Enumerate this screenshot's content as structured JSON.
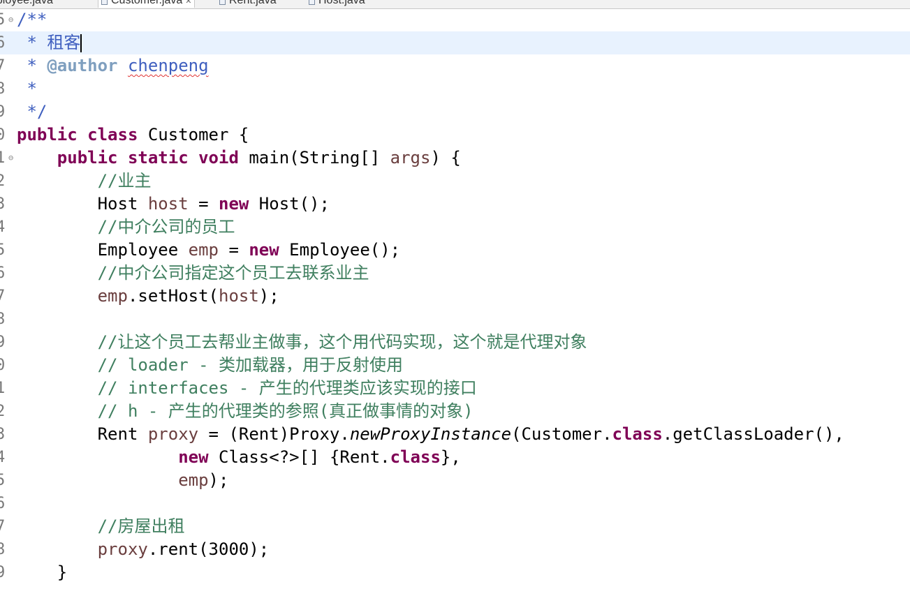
{
  "tabs": [
    {
      "label": "nployee.java",
      "active": false
    },
    {
      "label": "Customer.java",
      "active": true
    },
    {
      "label": "Rent.java",
      "active": false
    },
    {
      "label": "Host.java",
      "active": false
    }
  ],
  "lines": [
    {
      "num": "5",
      "fold": "⊖",
      "tokens": [
        {
          "t": "jdoc",
          "s": "/**"
        }
      ]
    },
    {
      "num": "6",
      "current": true,
      "cursor": true,
      "tokens": [
        {
          "t": "jdoc",
          "s": " * 租客"
        }
      ]
    },
    {
      "num": "7",
      "tokens": [
        {
          "t": "jdoc",
          "s": " * "
        },
        {
          "t": "tag",
          "s": "@author"
        },
        {
          "t": "jdoc",
          "s": " "
        },
        {
          "t": "spell",
          "s": "chenpeng"
        }
      ]
    },
    {
      "num": "8",
      "tokens": [
        {
          "t": "jdoc",
          "s": " *"
        }
      ]
    },
    {
      "num": "9",
      "tokens": [
        {
          "t": "jdoc",
          "s": " */"
        }
      ]
    },
    {
      "num": "0",
      "tokens": [
        {
          "t": "kw",
          "s": "public"
        },
        {
          "t": "plain",
          "s": " "
        },
        {
          "t": "kw",
          "s": "class"
        },
        {
          "t": "plain",
          "s": " Customer {"
        }
      ]
    },
    {
      "num": "1",
      "fold": "⊖",
      "tokens": [
        {
          "t": "plain",
          "s": "    "
        },
        {
          "t": "kw",
          "s": "public"
        },
        {
          "t": "plain",
          "s": " "
        },
        {
          "t": "kw",
          "s": "static"
        },
        {
          "t": "plain",
          "s": " "
        },
        {
          "t": "kw",
          "s": "void"
        },
        {
          "t": "plain",
          "s": " main(String[] "
        },
        {
          "t": "var",
          "s": "args"
        },
        {
          "t": "plain",
          "s": ") {"
        }
      ]
    },
    {
      "num": "2",
      "tokens": [
        {
          "t": "plain",
          "s": "        "
        },
        {
          "t": "com",
          "s": "//业主"
        }
      ]
    },
    {
      "num": "3",
      "tokens": [
        {
          "t": "plain",
          "s": "        Host "
        },
        {
          "t": "var",
          "s": "host"
        },
        {
          "t": "plain",
          "s": " = "
        },
        {
          "t": "kw",
          "s": "new"
        },
        {
          "t": "plain",
          "s": " Host();"
        }
      ]
    },
    {
      "num": "4",
      "tokens": [
        {
          "t": "plain",
          "s": "        "
        },
        {
          "t": "com",
          "s": "//中介公司的员工"
        }
      ]
    },
    {
      "num": "5",
      "tokens": [
        {
          "t": "plain",
          "s": "        Employee "
        },
        {
          "t": "var",
          "s": "emp"
        },
        {
          "t": "plain",
          "s": " = "
        },
        {
          "t": "kw",
          "s": "new"
        },
        {
          "t": "plain",
          "s": " Employee();"
        }
      ]
    },
    {
      "num": "6",
      "tokens": [
        {
          "t": "plain",
          "s": "        "
        },
        {
          "t": "com",
          "s": "//中介公司指定这个员工去联系业主"
        }
      ]
    },
    {
      "num": "7",
      "tokens": [
        {
          "t": "plain",
          "s": "        "
        },
        {
          "t": "var",
          "s": "emp"
        },
        {
          "t": "plain",
          "s": ".setHost("
        },
        {
          "t": "var",
          "s": "host"
        },
        {
          "t": "plain",
          "s": ");"
        }
      ]
    },
    {
      "num": "8",
      "tokens": []
    },
    {
      "num": "9",
      "tokens": [
        {
          "t": "plain",
          "s": "        "
        },
        {
          "t": "com",
          "s": "//让这个员工去帮业主做事，这个用代码实现，这个就是代理对象"
        }
      ]
    },
    {
      "num": "0",
      "tokens": [
        {
          "t": "plain",
          "s": "        "
        },
        {
          "t": "com",
          "s": "// loader - 类加载器，用于反射使用"
        }
      ]
    },
    {
      "num": "1",
      "tokens": [
        {
          "t": "plain",
          "s": "        "
        },
        {
          "t": "com",
          "s": "// interfaces - 产生的代理类应该实现的接口"
        }
      ]
    },
    {
      "num": "2",
      "tokens": [
        {
          "t": "plain",
          "s": "        "
        },
        {
          "t": "com",
          "s": "// h - 产生的代理类的参照(真正做事情的对象)"
        }
      ]
    },
    {
      "num": "3",
      "tokens": [
        {
          "t": "plain",
          "s": "        Rent "
        },
        {
          "t": "var",
          "s": "proxy"
        },
        {
          "t": "plain",
          "s": " = (Rent)Proxy."
        },
        {
          "t": "ital",
          "s": "newProxyInstance"
        },
        {
          "t": "plain",
          "s": "(Customer."
        },
        {
          "t": "kw",
          "s": "class"
        },
        {
          "t": "plain",
          "s": ".getClassLoader(),"
        }
      ]
    },
    {
      "num": "4",
      "tokens": [
        {
          "t": "plain",
          "s": "                "
        },
        {
          "t": "kw",
          "s": "new"
        },
        {
          "t": "plain",
          "s": " Class<?>[] {Rent."
        },
        {
          "t": "kw",
          "s": "class"
        },
        {
          "t": "plain",
          "s": "},"
        }
      ]
    },
    {
      "num": "5",
      "tokens": [
        {
          "t": "plain",
          "s": "                "
        },
        {
          "t": "var",
          "s": "emp"
        },
        {
          "t": "plain",
          "s": ");"
        }
      ]
    },
    {
      "num": "6",
      "tokens": []
    },
    {
      "num": "7",
      "tokens": [
        {
          "t": "plain",
          "s": "        "
        },
        {
          "t": "com",
          "s": "//房屋出租"
        }
      ]
    },
    {
      "num": "8",
      "tokens": [
        {
          "t": "plain",
          "s": "        "
        },
        {
          "t": "var",
          "s": "proxy"
        },
        {
          "t": "plain",
          "s": ".rent(3000);"
        }
      ]
    },
    {
      "num": "9",
      "tokens": [
        {
          "t": "plain",
          "s": "    }"
        }
      ]
    }
  ],
  "colors": {
    "keyword": "#7f0055",
    "javadoc": "#3f5fbf",
    "javadoc_tag": "#7f9fbf",
    "comment": "#3f7f5f",
    "local_variable": "#6a3e3e",
    "current_line": "#e8f2fe"
  }
}
